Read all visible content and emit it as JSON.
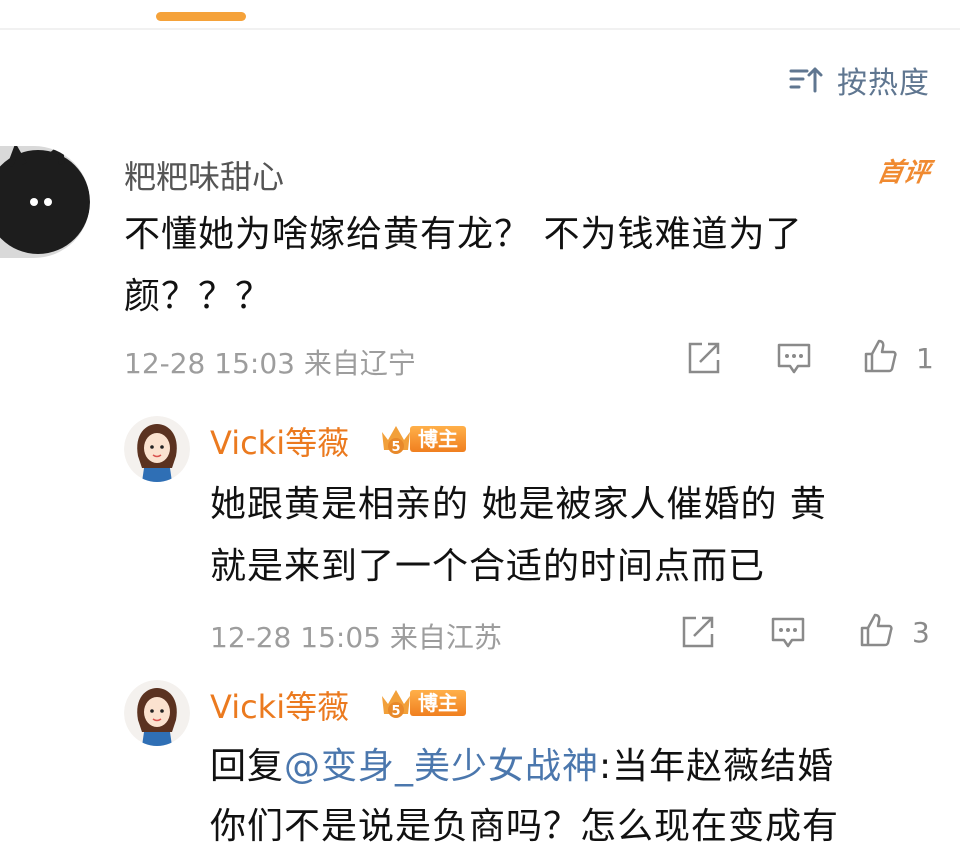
{
  "sort": {
    "label": "按热度"
  },
  "comment": {
    "username": "粑粑味甜心",
    "first_badge": "首评",
    "text_line1": "不懂她为啥嫁给黄有龙？ 不为钱难道为了",
    "text_line2": "颜？？？",
    "time_location": "12-28 15:03 来自辽宁",
    "like_count": "1"
  },
  "replies": [
    {
      "username": "Vicki等薇",
      "level": "5",
      "badge_label": "博主",
      "text_line1": "她跟黄是相亲的 她是被家人催婚的 黄",
      "text_line2": "就是来到了一个合适的时间点而已",
      "time_location": "12-28 15:05 来自江苏",
      "like_count": "3"
    },
    {
      "username": "Vicki等薇",
      "level": "5",
      "badge_label": "博主",
      "reply_prefix": "回复",
      "mention": "@变身_美少女战神",
      "text_after_mention": ":当年赵薇结婚",
      "text_line2": "你们不是说是负商吗？怎么现在变成有"
    }
  ],
  "colors": {
    "accent_orange": "#eb7a1f",
    "link_blue": "#4b77ad",
    "meta_gray": "#9d9d9d"
  }
}
